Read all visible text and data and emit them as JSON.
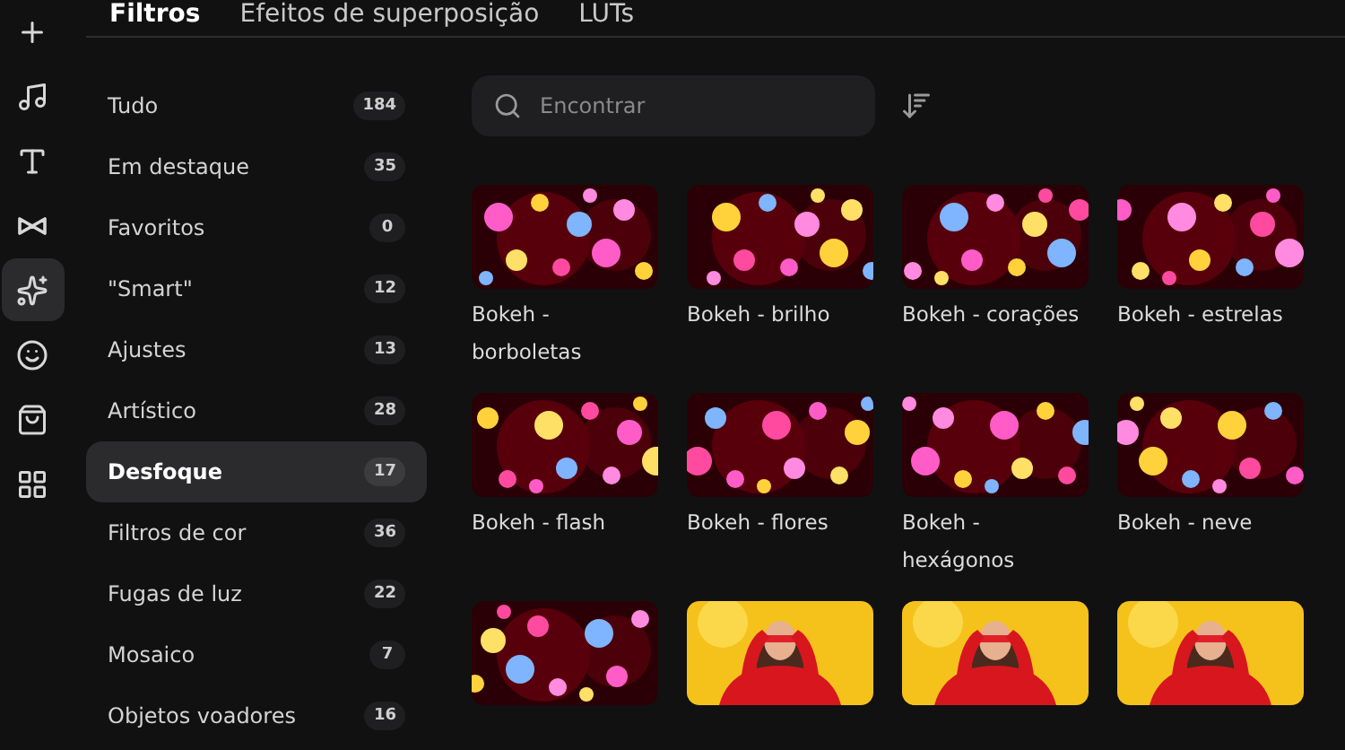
{
  "rail": [
    {
      "kind": "plus",
      "selected": false
    },
    {
      "kind": "music",
      "selected": false
    },
    {
      "kind": "text",
      "selected": false
    },
    {
      "kind": "transition",
      "selected": false
    },
    {
      "kind": "effects",
      "selected": true
    },
    {
      "kind": "sticker",
      "selected": false
    },
    {
      "kind": "bag",
      "selected": false
    },
    {
      "kind": "apps",
      "selected": false
    }
  ],
  "tabs": [
    {
      "label": "Filtros",
      "selected": true
    },
    {
      "label": "Efeitos de superposição",
      "selected": false
    },
    {
      "label": "LUTs",
      "selected": false
    }
  ],
  "categories": [
    {
      "label": "Tudo",
      "count": "184",
      "selected": false
    },
    {
      "label": "Em destaque",
      "count": "35",
      "selected": false
    },
    {
      "label": "Favoritos",
      "count": "0",
      "selected": false
    },
    {
      "label": "\"Smart\"",
      "count": "12",
      "selected": false
    },
    {
      "label": "Ajustes",
      "count": "13",
      "selected": false
    },
    {
      "label": "Artístico",
      "count": "28",
      "selected": false
    },
    {
      "label": "Desfoque",
      "count": "17",
      "selected": true
    },
    {
      "label": "Filtros de cor",
      "count": "36",
      "selected": false
    },
    {
      "label": "Fugas de luz",
      "count": "22",
      "selected": false
    },
    {
      "label": "Mosaico",
      "count": "7",
      "selected": false
    },
    {
      "label": "Objetos voadores",
      "count": "16",
      "selected": false
    }
  ],
  "search": {
    "placeholder": "Encontrar"
  },
  "filters": [
    {
      "name": "Bokeh - borboletas",
      "kind": "bokeh"
    },
    {
      "name": "Bokeh - brilho",
      "kind": "bokeh"
    },
    {
      "name": "Bokeh - corações",
      "kind": "bokeh"
    },
    {
      "name": "Bokeh - estrelas",
      "kind": "bokeh"
    },
    {
      "name": "Bokeh - flash",
      "kind": "bokeh"
    },
    {
      "name": "Bokeh - flores",
      "kind": "bokeh"
    },
    {
      "name": "Bokeh - hexágonos",
      "kind": "bokeh"
    },
    {
      "name": "Bokeh - neve",
      "kind": "bokeh"
    },
    {
      "kind": "bokeh"
    },
    {
      "kind": "portrait"
    },
    {
      "kind": "portrait"
    },
    {
      "kind": "portrait"
    }
  ]
}
